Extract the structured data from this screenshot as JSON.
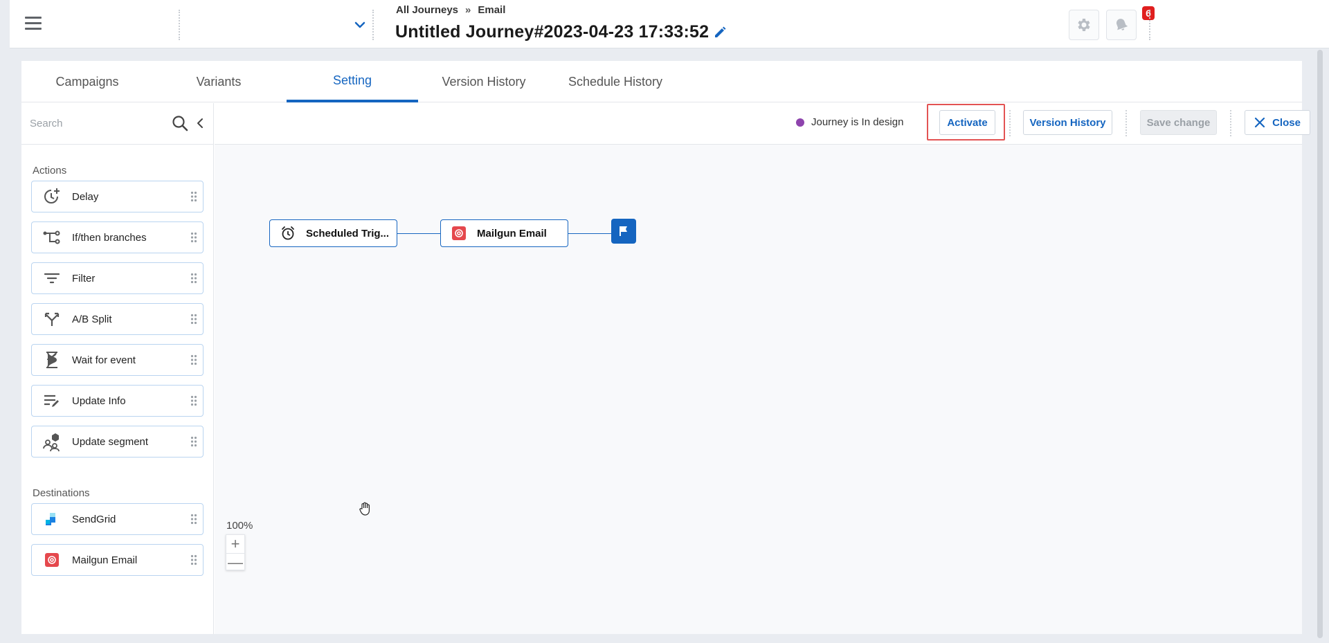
{
  "header": {
    "breadcrumb": {
      "all_journeys": "All Journeys",
      "separator": "»",
      "current": "Email"
    },
    "title": "Untitled Journey#2023-04-23 17:33:52",
    "notifications_count": "6"
  },
  "tabs": [
    {
      "label": "Campaigns"
    },
    {
      "label": "Variants"
    },
    {
      "label": "Setting",
      "active": true
    },
    {
      "label": "Version History"
    },
    {
      "label": "Schedule History"
    }
  ],
  "sidebar": {
    "search_placeholder": "Search",
    "actions_title": "Actions",
    "actions": [
      {
        "label": "Delay",
        "icon": "delay-clock-icon"
      },
      {
        "label": "If/then branches",
        "icon": "branch-icon"
      },
      {
        "label": "Filter",
        "icon": "filter-icon"
      },
      {
        "label": "A/B Split",
        "icon": "split-icon"
      },
      {
        "label": "Wait for event",
        "icon": "hourglass-icon"
      },
      {
        "label": "Update Info",
        "icon": "edit-list-icon"
      },
      {
        "label": "Update segment",
        "icon": "segment-icon"
      }
    ],
    "destinations_title": "Destinations",
    "destinations": [
      {
        "label": "SendGrid",
        "icon": "sendgrid-icon"
      },
      {
        "label": "Mailgun Email",
        "icon": "mailgun-icon"
      }
    ]
  },
  "toolbar": {
    "status_text": "Journey is In design",
    "status_color": "#8e44ad",
    "activate": "Activate",
    "version_history": "Version History",
    "save_change": "Save change",
    "close": "Close"
  },
  "flow": {
    "nodes": [
      {
        "label": "Scheduled Trig...",
        "icon": "alarm-clock-icon"
      },
      {
        "label": "Mailgun Email",
        "icon": "mailgun-icon"
      }
    ],
    "end_icon": "flag-icon"
  },
  "zoom": {
    "level": "100%",
    "zoom_in": "+",
    "zoom_out": "—"
  },
  "colors": {
    "accent": "#1565c0",
    "highlight": "#e35353",
    "mailgun": "#e5484d",
    "sendgrid": "#1a82e2"
  }
}
